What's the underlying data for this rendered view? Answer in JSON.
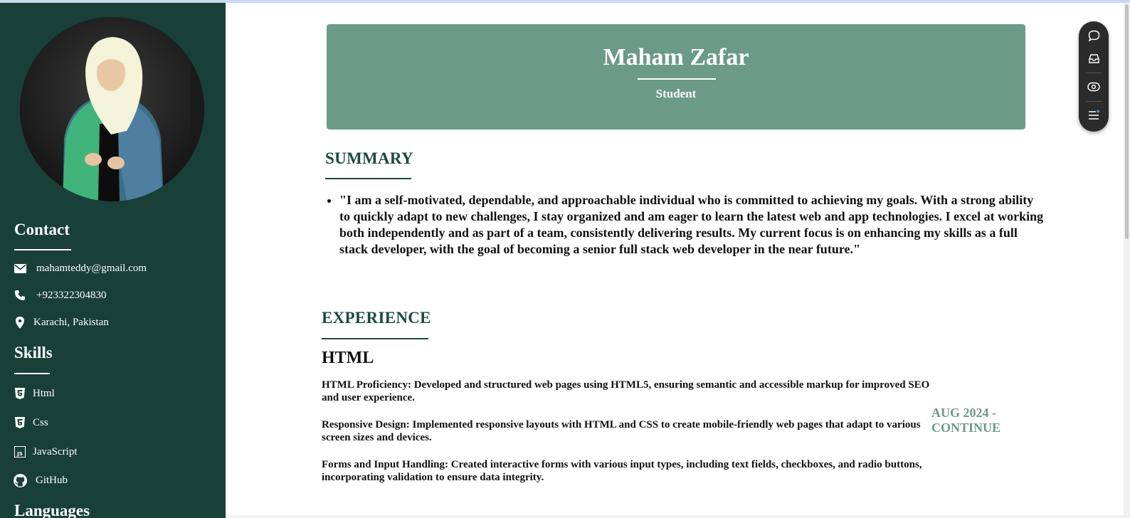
{
  "sidebar": {
    "contact_heading": "Contact",
    "contact": [
      {
        "icon": "envelope-icon",
        "text": "mahamteddy@gmail.com"
      },
      {
        "icon": "phone-icon",
        "text": "+923322304830"
      },
      {
        "icon": "map-pin-icon",
        "text": "Karachi, Pakistan"
      }
    ],
    "skills_heading": "Skills",
    "skills": [
      {
        "icon": "html5-icon",
        "text": "Html"
      },
      {
        "icon": "css3-icon",
        "text": "Css"
      },
      {
        "icon": "javascript-icon",
        "text": "JavaScript"
      },
      {
        "icon": "github-icon",
        "text": "GitHub"
      }
    ],
    "languages_heading": "Languages"
  },
  "header": {
    "name": "Maham Zafar",
    "role": "Student"
  },
  "summary": {
    "title": "SUMMARY",
    "text": "\"I am a self-motivated, dependable, and approachable individual who is committed to achieving my goals. With a strong ability to quickly adapt to new challenges, I stay organized and am eager to learn the latest web and app technologies. I excel at working both independently and as part of a team, consistently delivering results. My current focus is on enhancing my skills as a full stack developer, with the goal of becoming a senior full stack web developer in the near future.\""
  },
  "experience": {
    "title": "EXPERIENCE",
    "items": [
      {
        "heading": "HTML",
        "points": [
          "HTML Proficiency: Developed and structured web pages using HTML5, ensuring semantic and accessible markup for improved SEO and user experience.",
          "Responsive Design: Implemented responsive layouts with HTML and CSS to create mobile-friendly web pages that adapt to various screen sizes and devices.",
          "Forms and Input Handling: Created interactive forms with various input types, including text fields, checkboxes, and radio buttons, incorporating validation to ensure data integrity."
        ],
        "date": "AUG 2024 - CONTINUE"
      }
    ]
  },
  "floating_toolbar": [
    "chat-bubble-icon",
    "inbox-icon",
    "eye-icon",
    "menu-icon"
  ],
  "colors": {
    "sidebar_bg": "#183f38",
    "header_bg": "#6c9a89",
    "accent_dark": "#1b4a40",
    "date_color": "#6c9a89"
  }
}
